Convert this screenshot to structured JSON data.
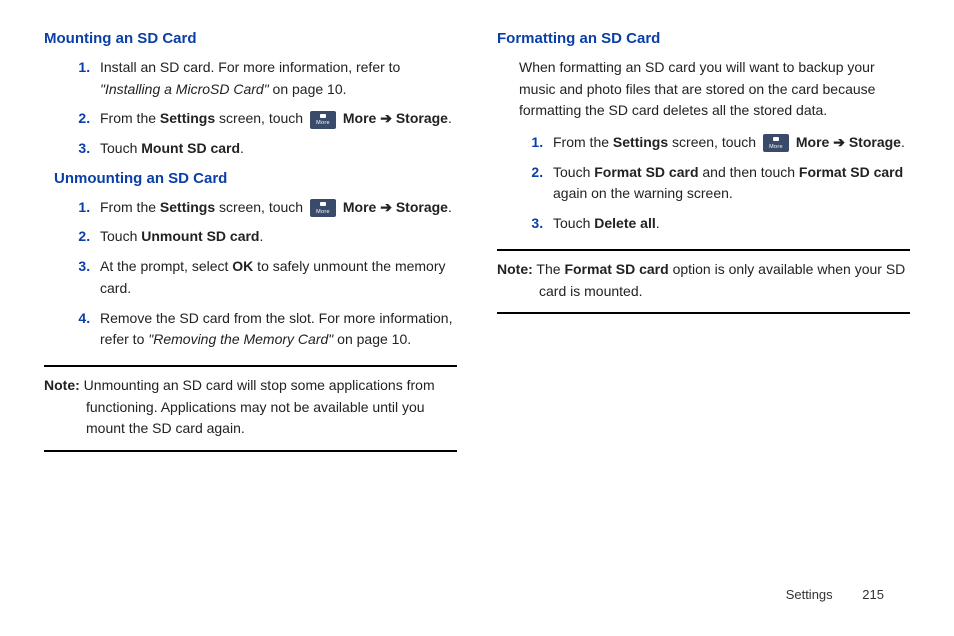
{
  "left": {
    "mount_heading": "Mounting an SD Card",
    "mount_steps": {
      "s1a": "Install an SD card. For more information, refer to ",
      "s1b": "\"Installing a MicroSD Card\"",
      "s1c": " on page 10.",
      "s2a": "From the ",
      "s2b": "Settings",
      "s2c": " screen, touch ",
      "s2d": " More ",
      "s2e": "➔",
      "s2f": "Storage",
      "s2g": ".",
      "s3a": "Touch ",
      "s3b": "Mount SD card",
      "s3c": "."
    },
    "unmount_heading": "Unmounting an SD Card",
    "unmount_steps": {
      "s1a": "From the ",
      "s1b": "Settings",
      "s1c": " screen, touch ",
      "s1d": " More ",
      "s1e": "➔",
      "s1f": "Storage",
      "s1g": ".",
      "s2a": "Touch ",
      "s2b": "Unmount SD card",
      "s2c": ".",
      "s3a": "At the prompt, select ",
      "s3b": "OK",
      "s3c": " to safely unmount the memory card.",
      "s4a": "Remove the SD card from the slot. For more information, refer to ",
      "s4b": "\"Removing the Memory Card\"",
      "s4c": " on page 10."
    },
    "note_label": "Note:",
    "note_body": " Unmounting an SD card will stop some applications from functioning. Applications may not be available until you mount the SD card again."
  },
  "right": {
    "format_heading": "Formatting an SD Card",
    "intro": "When formatting an SD card you will want to backup your music and photo files that are stored on the card because formatting the SD card deletes all the stored data.",
    "steps": {
      "s1a": "From the ",
      "s1b": "Settings",
      "s1c": " screen, touch ",
      "s1d": " More ",
      "s1e": "➔",
      "s1f": "Storage",
      "s1g": ".",
      "s2a": "Touch ",
      "s2b": "Format SD card",
      "s2c": " and then touch ",
      "s2d": "Format SD card",
      "s2e": " again on the warning screen.",
      "s3a": "Touch ",
      "s3b": "Delete all",
      "s3c": "."
    },
    "note_label": "Note:",
    "note_a": " The ",
    "note_b": "Format SD card",
    "note_c": " option is only available when your SD card is mounted."
  },
  "footer": {
    "section": "Settings",
    "page": "215"
  }
}
